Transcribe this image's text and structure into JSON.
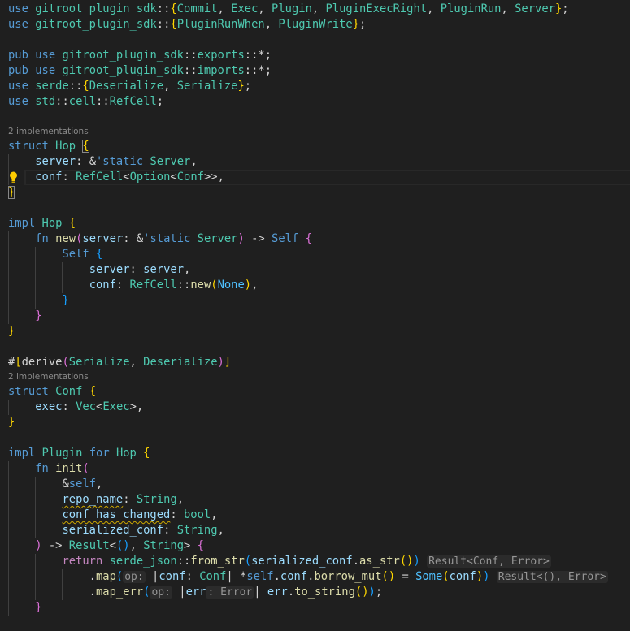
{
  "editor": {
    "language": "rust",
    "current_line_icon": "lightbulb-icon",
    "colors": {
      "background": "#1f1f1f",
      "keyword": "#569cd6",
      "type": "#4ec9b0",
      "variable": "#9cdcfe",
      "function": "#dcdcaa",
      "bracket_gold": "#ffd700",
      "bracket_pink": "#da70d6",
      "bracket_blue": "#179fff",
      "squiggle": "#cca700"
    },
    "lines": [
      {
        "tokens": [
          [
            "use",
            "k"
          ],
          [
            " ",
            "p"
          ],
          [
            "gitroot_plugin_sdk",
            "t"
          ],
          [
            "::",
            "p"
          ],
          [
            "{",
            "b1"
          ],
          [
            "Commit",
            "t"
          ],
          [
            ", ",
            "p"
          ],
          [
            "Exec",
            "t"
          ],
          [
            ", ",
            "p"
          ],
          [
            "Plugin",
            "t"
          ],
          [
            ", ",
            "p"
          ],
          [
            "PluginExecRight",
            "t"
          ],
          [
            ", ",
            "p"
          ],
          [
            "PluginRun",
            "t"
          ],
          [
            ", ",
            "p"
          ],
          [
            "Server",
            "t"
          ],
          [
            "}",
            "b1"
          ],
          [
            ";",
            "p"
          ]
        ]
      },
      {
        "tokens": [
          [
            "use",
            "k"
          ],
          [
            " ",
            "p"
          ],
          [
            "gitroot_plugin_sdk",
            "t"
          ],
          [
            "::",
            "p"
          ],
          [
            "{",
            "b1"
          ],
          [
            "PluginRunWhen",
            "t"
          ],
          [
            ", ",
            "p"
          ],
          [
            "PluginWrite",
            "t"
          ],
          [
            "}",
            "b1"
          ],
          [
            ";",
            "p"
          ]
        ]
      },
      {
        "tokens": []
      },
      {
        "tokens": [
          [
            "pub",
            "k"
          ],
          [
            " ",
            "p"
          ],
          [
            "use",
            "k"
          ],
          [
            " ",
            "p"
          ],
          [
            "gitroot_plugin_sdk",
            "t"
          ],
          [
            "::",
            "p"
          ],
          [
            "exports",
            "t"
          ],
          [
            "::*;",
            "p"
          ]
        ]
      },
      {
        "tokens": [
          [
            "pub",
            "k"
          ],
          [
            " ",
            "p"
          ],
          [
            "use",
            "k"
          ],
          [
            " ",
            "p"
          ],
          [
            "gitroot_plugin_sdk",
            "t"
          ],
          [
            "::",
            "p"
          ],
          [
            "imports",
            "t"
          ],
          [
            "::*;",
            "p"
          ]
        ]
      },
      {
        "tokens": [
          [
            "use",
            "k"
          ],
          [
            " ",
            "p"
          ],
          [
            "serde",
            "t"
          ],
          [
            "::",
            "p"
          ],
          [
            "{",
            "b1"
          ],
          [
            "Deserialize",
            "t"
          ],
          [
            ", ",
            "p"
          ],
          [
            "Serialize",
            "t"
          ],
          [
            "}",
            "b1"
          ],
          [
            ";",
            "p"
          ]
        ]
      },
      {
        "tokens": [
          [
            "use",
            "k"
          ],
          [
            " ",
            "p"
          ],
          [
            "std",
            "t"
          ],
          [
            "::",
            "p"
          ],
          [
            "cell",
            "t"
          ],
          [
            "::",
            "p"
          ],
          [
            "RefCell",
            "t"
          ],
          [
            ";",
            "p"
          ]
        ]
      },
      {
        "tokens": []
      },
      {
        "lens": "2 implementations"
      },
      {
        "tokens": [
          [
            "struct",
            "k"
          ],
          [
            " ",
            "p"
          ],
          [
            "Hop",
            "t"
          ],
          [
            " ",
            "p"
          ],
          [
            "{",
            "b1 mb"
          ]
        ]
      },
      {
        "tokens": [
          [
            "    ",
            "p"
          ],
          [
            "server",
            "v"
          ],
          [
            ": &",
            "p"
          ],
          [
            "'static",
            "k"
          ],
          [
            " ",
            "p"
          ],
          [
            "Server",
            "t"
          ],
          [
            ",",
            "p"
          ]
        ]
      },
      {
        "current": true,
        "tokens": [
          [
            "    ",
            "p"
          ],
          [
            "conf",
            "v"
          ],
          [
            ": ",
            "p"
          ],
          [
            "RefCell",
            "t"
          ],
          [
            "<",
            "p"
          ],
          [
            "Option",
            "t"
          ],
          [
            "<",
            "p"
          ],
          [
            "Conf",
            "t"
          ],
          [
            ">>,",
            "p"
          ]
        ]
      },
      {
        "tokens": [
          [
            "}",
            "b1 mb"
          ]
        ]
      },
      {
        "tokens": []
      },
      {
        "tokens": [
          [
            "impl",
            "k"
          ],
          [
            " ",
            "p"
          ],
          [
            "Hop",
            "t"
          ],
          [
            " ",
            "p"
          ],
          [
            "{",
            "b1"
          ]
        ]
      },
      {
        "tokens": [
          [
            "    ",
            "p"
          ],
          [
            "fn",
            "k"
          ],
          [
            " ",
            "p"
          ],
          [
            "new",
            "f"
          ],
          [
            "(",
            "b2"
          ],
          [
            "server",
            "v"
          ],
          [
            ": &",
            "p"
          ],
          [
            "'static",
            "k"
          ],
          [
            " ",
            "p"
          ],
          [
            "Server",
            "t"
          ],
          [
            ")",
            "b2"
          ],
          [
            " -> ",
            "p"
          ],
          [
            "Self",
            "k"
          ],
          [
            " ",
            "p"
          ],
          [
            "{",
            "b2"
          ]
        ]
      },
      {
        "tokens": [
          [
            "        ",
            "p"
          ],
          [
            "Self",
            "k"
          ],
          [
            " ",
            "p"
          ],
          [
            "{",
            "b3"
          ]
        ]
      },
      {
        "tokens": [
          [
            "            ",
            "p"
          ],
          [
            "server",
            "v"
          ],
          [
            ": ",
            "p"
          ],
          [
            "server",
            "v"
          ],
          [
            ",",
            "p"
          ]
        ]
      },
      {
        "tokens": [
          [
            "            ",
            "p"
          ],
          [
            "conf",
            "v"
          ],
          [
            ": ",
            "p"
          ],
          [
            "RefCell",
            "t"
          ],
          [
            "::",
            "p"
          ],
          [
            "new",
            "f"
          ],
          [
            "(",
            "b1"
          ],
          [
            "None",
            "e"
          ],
          [
            ")",
            "b1"
          ],
          [
            ",",
            "p"
          ]
        ]
      },
      {
        "tokens": [
          [
            "        ",
            "p"
          ],
          [
            "}",
            "b3"
          ]
        ]
      },
      {
        "tokens": [
          [
            "    ",
            "p"
          ],
          [
            "}",
            "b2"
          ]
        ]
      },
      {
        "tokens": [
          [
            "}",
            "b1"
          ]
        ]
      },
      {
        "tokens": []
      },
      {
        "tokens": [
          [
            "#",
            "p"
          ],
          [
            "[",
            "b1"
          ],
          [
            "derive",
            "p"
          ],
          [
            "(",
            "b2"
          ],
          [
            "Serialize",
            "t"
          ],
          [
            ", ",
            "p"
          ],
          [
            "Deserialize",
            "t"
          ],
          [
            ")",
            "b2"
          ],
          [
            "]",
            "b1"
          ]
        ]
      },
      {
        "lens": "2 implementations"
      },
      {
        "tokens": [
          [
            "struct",
            "k"
          ],
          [
            " ",
            "p"
          ],
          [
            "Conf",
            "t"
          ],
          [
            " ",
            "p"
          ],
          [
            "{",
            "b1"
          ]
        ]
      },
      {
        "tokens": [
          [
            "    ",
            "p"
          ],
          [
            "exec",
            "v"
          ],
          [
            ": ",
            "p"
          ],
          [
            "Vec",
            "t"
          ],
          [
            "<",
            "p"
          ],
          [
            "Exec",
            "t"
          ],
          [
            ">,",
            "p"
          ]
        ]
      },
      {
        "tokens": [
          [
            "}",
            "b1"
          ]
        ]
      },
      {
        "tokens": []
      },
      {
        "tokens": [
          [
            "impl",
            "k"
          ],
          [
            " ",
            "p"
          ],
          [
            "Plugin",
            "t"
          ],
          [
            " ",
            "p"
          ],
          [
            "for",
            "k"
          ],
          [
            " ",
            "p"
          ],
          [
            "Hop",
            "t"
          ],
          [
            " ",
            "p"
          ],
          [
            "{",
            "b1"
          ]
        ]
      },
      {
        "tokens": [
          [
            "    ",
            "p"
          ],
          [
            "fn",
            "k"
          ],
          [
            " ",
            "p"
          ],
          [
            "init",
            "f"
          ],
          [
            "(",
            "b2"
          ]
        ]
      },
      {
        "tokens": [
          [
            "        ",
            "p"
          ],
          [
            "&",
            "p"
          ],
          [
            "self",
            "k"
          ],
          [
            ",",
            "p"
          ]
        ]
      },
      {
        "tokens": [
          [
            "        ",
            "p"
          ],
          [
            "repo_name",
            "v sq"
          ],
          [
            ": ",
            "p"
          ],
          [
            "String",
            "t"
          ],
          [
            ",",
            "p"
          ]
        ]
      },
      {
        "tokens": [
          [
            "        ",
            "p"
          ],
          [
            "conf_has_changed",
            "v sq"
          ],
          [
            ": ",
            "p"
          ],
          [
            "bool",
            "t"
          ],
          [
            ",",
            "p"
          ]
        ]
      },
      {
        "tokens": [
          [
            "        ",
            "p"
          ],
          [
            "serialized_conf",
            "v"
          ],
          [
            ": ",
            "p"
          ],
          [
            "String",
            "t"
          ],
          [
            ",",
            "p"
          ]
        ]
      },
      {
        "tokens": [
          [
            "    ",
            "p"
          ],
          [
            ")",
            "b2"
          ],
          [
            " -> ",
            "p"
          ],
          [
            "Result",
            "t"
          ],
          [
            "<",
            "p"
          ],
          [
            "(",
            "b3"
          ],
          [
            ")",
            "b3"
          ],
          [
            ", ",
            "p"
          ],
          [
            "String",
            "t"
          ],
          [
            "> ",
            "p"
          ],
          [
            "{",
            "b2"
          ]
        ]
      },
      {
        "tokens": [
          [
            "        ",
            "p"
          ],
          [
            "return",
            "c"
          ],
          [
            " ",
            "p"
          ],
          [
            "serde_json",
            "t"
          ],
          [
            "::",
            "p"
          ],
          [
            "from_str",
            "f"
          ],
          [
            "(",
            "b3"
          ],
          [
            "serialized_conf",
            "v"
          ],
          [
            ".",
            "p"
          ],
          [
            "as_str",
            "f"
          ],
          [
            "(",
            "b1"
          ],
          [
            ")",
            "b1"
          ],
          [
            ")",
            "b3"
          ],
          [
            " ",
            "p"
          ],
          [
            "Result<Conf, Error>",
            "h"
          ]
        ]
      },
      {
        "tokens": [
          [
            "            .",
            "p"
          ],
          [
            "map",
            "f"
          ],
          [
            "(",
            "b3"
          ],
          [
            "op:",
            "h"
          ],
          [
            " |",
            "p"
          ],
          [
            "conf",
            "v"
          ],
          [
            ": ",
            "p"
          ],
          [
            "Conf",
            "t"
          ],
          [
            "| *",
            "p"
          ],
          [
            "self",
            "k"
          ],
          [
            ".",
            "p"
          ],
          [
            "conf",
            "v"
          ],
          [
            ".",
            "p"
          ],
          [
            "borrow_mut",
            "f"
          ],
          [
            "(",
            "b1"
          ],
          [
            ")",
            "b1"
          ],
          [
            " = ",
            "p"
          ],
          [
            "Some",
            "e"
          ],
          [
            "(",
            "b1"
          ],
          [
            "conf",
            "v"
          ],
          [
            ")",
            "b1"
          ],
          [
            ")",
            "b3"
          ],
          [
            " ",
            "p"
          ],
          [
            "Result<(), Error>",
            "h"
          ]
        ]
      },
      {
        "tokens": [
          [
            "            .",
            "p"
          ],
          [
            "map_err",
            "f"
          ],
          [
            "(",
            "b3"
          ],
          [
            "op:",
            "h"
          ],
          [
            " |",
            "p"
          ],
          [
            "err",
            "v"
          ],
          [
            ": Error",
            "h"
          ],
          [
            "| ",
            "p"
          ],
          [
            "err",
            "v"
          ],
          [
            ".",
            "p"
          ],
          [
            "to_string",
            "f"
          ],
          [
            "(",
            "b1"
          ],
          [
            ")",
            "b1"
          ],
          [
            ")",
            "b3"
          ],
          [
            ";",
            "p"
          ]
        ]
      },
      {
        "tokens": [
          [
            "    ",
            "p"
          ],
          [
            "}",
            "b2"
          ]
        ]
      },
      {
        "tokens": []
      }
    ]
  }
}
